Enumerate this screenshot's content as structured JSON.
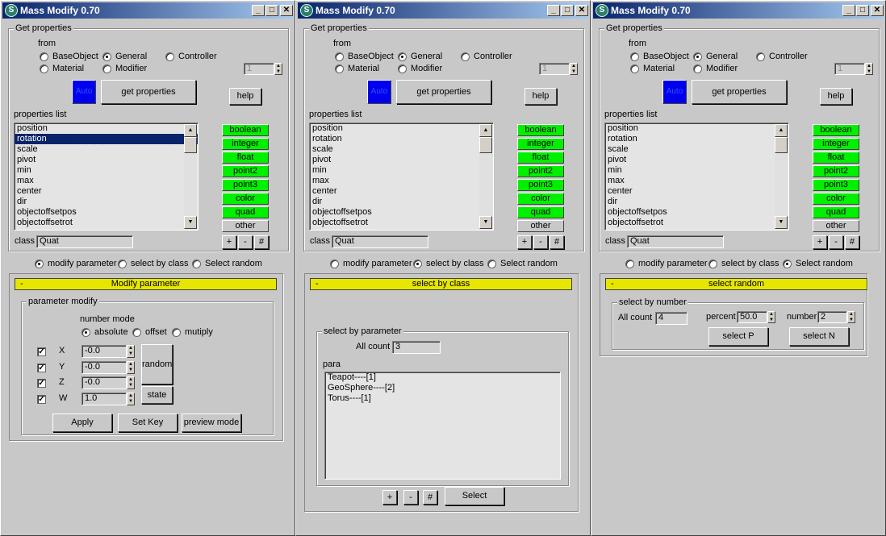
{
  "window": {
    "title": "Mass Modify 0.70",
    "min": "_",
    "max": "□",
    "close": "✕"
  },
  "common": {
    "get_properties_group": "Get properties",
    "from": "from",
    "from_options": {
      "baseobject": "BaseObject",
      "general": "General",
      "controller": "Controller",
      "material": "Material",
      "modifier": "Modifier"
    },
    "index_value": "1",
    "auto_label": "Auto",
    "get_properties_btn": "get properties",
    "help_btn": "help",
    "properties_list_label": "properties list",
    "properties": [
      "position",
      "rotation",
      "scale",
      "pivot",
      "min",
      "max",
      "center",
      "dir",
      "objectoffsetpos",
      "objectoffsetrot"
    ],
    "type_buttons": [
      "boolean",
      "integer",
      "float",
      "point2",
      "point3",
      "color",
      "quad"
    ],
    "other_btn": "other",
    "class_label": "class",
    "class_value": "Quat",
    "plus": "+",
    "minus": "-",
    "hash": "#",
    "mode_options": {
      "modify": "modify parameter",
      "select_class": "select by class",
      "select_random": "Select random"
    }
  },
  "panel1": {
    "selected_property": "rotation",
    "rollout_minus": "-",
    "rollout_title": "Modify parameter",
    "param_group": "parameter modify",
    "number_mode": "number mode",
    "mode_absolute": "absolute",
    "mode_offset": "offset",
    "mode_mutiply": "mutiply",
    "axes": [
      {
        "label": "X",
        "value": "-0.0"
      },
      {
        "label": "Y",
        "value": "-0.0"
      },
      {
        "label": "Z",
        "value": "-0.0"
      },
      {
        "label": "W",
        "value": "1.0"
      }
    ],
    "check_mark": "✓",
    "random_btn": "random",
    "state_btn": "state",
    "apply_btn": "Apply",
    "setkey_btn": "Set Key",
    "preview_btn": "preview mode"
  },
  "panel2": {
    "rollout_minus": "-",
    "rollout_title": "select by class",
    "param_group": "select by parameter",
    "all_count_label": "All count",
    "all_count_value": "3",
    "para_label": "para",
    "para_items": [
      "Teapot----[1]",
      "GeoSphere----[2]",
      "Torus----[1]"
    ],
    "select_btn": "Select"
  },
  "panel3": {
    "rollout_minus": "-",
    "rollout_title": "select random",
    "number_group": "select by number",
    "all_count_label": "All count",
    "all_count_value": "4",
    "percent_label": "percent",
    "percent_value": "50.0",
    "number_label": "number",
    "number_value": "2",
    "select_p_btn": "select P",
    "select_n_btn": "select N"
  },
  "colors": {
    "type_button": "#00f000",
    "rollout_header": "#e6e600",
    "auto_swatch": "#0000ee",
    "titlebar": "#0a246a"
  }
}
